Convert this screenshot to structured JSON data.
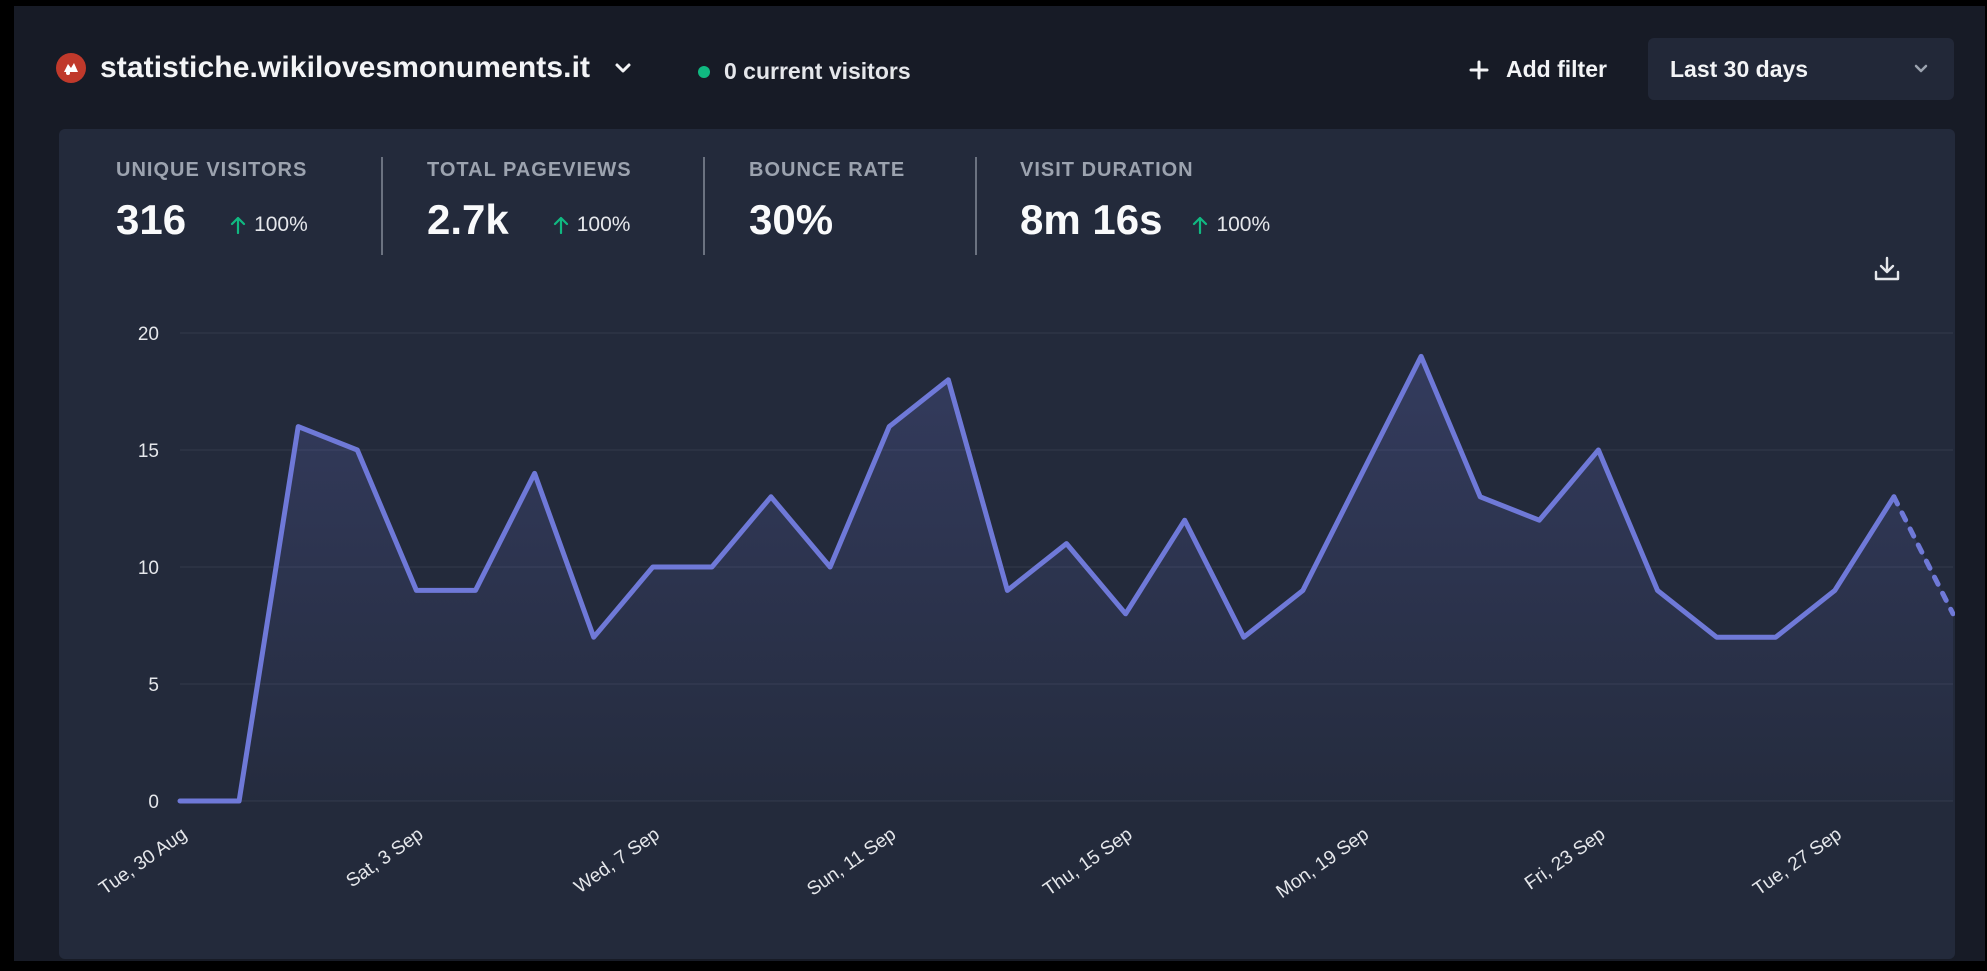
{
  "header": {
    "site_name": "statistiche.wikilovesmonuments.it",
    "current_visitors": "0 current visitors",
    "add_filter": "Add filter",
    "period": "Last 30 days",
    "icons": [
      "favicon-icon",
      "chevron-down-icon",
      "live-dot-icon",
      "plus-icon",
      "download-icon",
      "arrow-up-icon"
    ]
  },
  "stats": [
    {
      "label": "UNIQUE VISITORS",
      "value": "316",
      "change": "100%"
    },
    {
      "label": "TOTAL PAGEVIEWS",
      "value": "2.7k",
      "change": "100%"
    },
    {
      "label": "BOUNCE RATE",
      "value": "30%",
      "change": ""
    },
    {
      "label": "VISIT DURATION",
      "value": "8m 16s",
      "change": "100%"
    }
  ],
  "colors": {
    "line": "#6f79d8",
    "positive": "#10b981",
    "background": "#171b26",
    "card": "#232a3b"
  },
  "chart_data": {
    "type": "line",
    "title": "",
    "xlabel": "",
    "ylabel": "",
    "ylim": [
      0,
      20
    ],
    "yticks": [
      "0",
      "5",
      "10",
      "15",
      "20"
    ],
    "x": [
      "30 Aug",
      "31 Aug",
      "1 Sep",
      "2 Sep",
      "3 Sep",
      "4 Sep",
      "5 Sep",
      "6 Sep",
      "7 Sep",
      "8 Sep",
      "9 Sep",
      "10 Sep",
      "11 Sep",
      "12 Sep",
      "13 Sep",
      "14 Sep",
      "15 Sep",
      "16 Sep",
      "17 Sep",
      "18 Sep",
      "19 Sep",
      "20 Sep",
      "21 Sep",
      "22 Sep",
      "23 Sep",
      "24 Sep",
      "25 Sep",
      "26 Sep",
      "27 Sep",
      "28 Sep",
      "29 Sep"
    ],
    "xtick_labels": [
      "Tue, 30 Aug",
      "Sat, 3 Sep",
      "Wed, 7 Sep",
      "Sun, 11 Sep",
      "Thu, 15 Sep",
      "Mon, 19 Sep",
      "Fri, 23 Sep",
      "Tue, 27 Sep"
    ],
    "series": [
      {
        "values": [
          0,
          0,
          16,
          15,
          9,
          9,
          14,
          7,
          10,
          10,
          13,
          10,
          16,
          18,
          9,
          11,
          8,
          12,
          7,
          9,
          14,
          19,
          13,
          12,
          15,
          9,
          7,
          7,
          9,
          13,
          8
        ]
      }
    ],
    "incomplete_last_point": true,
    "grid": true
  }
}
